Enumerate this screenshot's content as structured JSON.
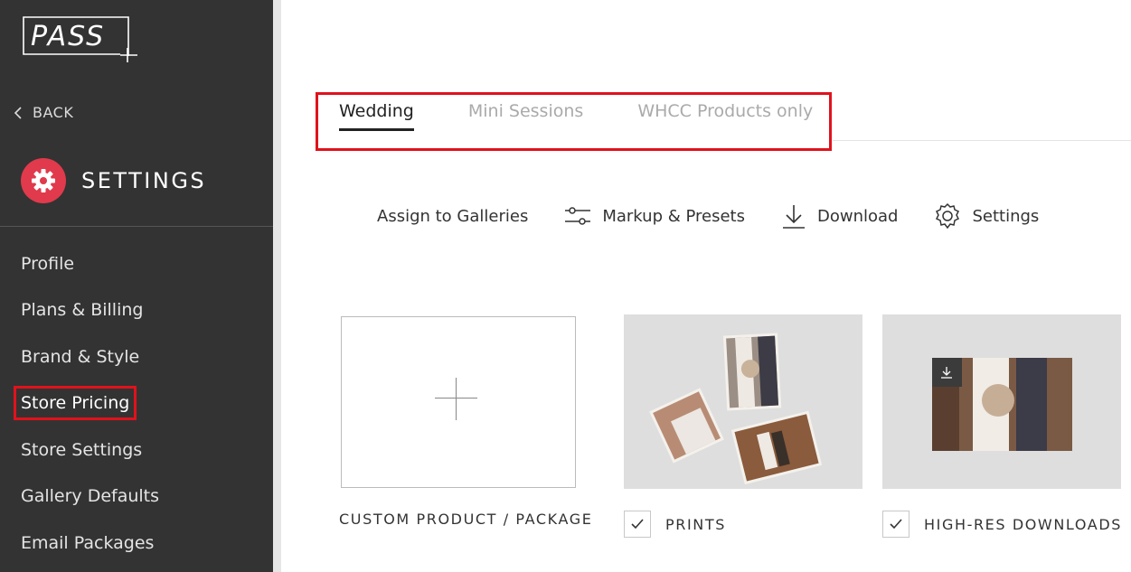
{
  "sidebar": {
    "logo_text": "PASS",
    "back_label": "BACK",
    "section_title": "SETTINGS",
    "items": [
      {
        "label": "Profile"
      },
      {
        "label": "Plans & Billing"
      },
      {
        "label": "Brand & Style"
      },
      {
        "label": "Store Pricing"
      },
      {
        "label": "Store Settings"
      },
      {
        "label": "Gallery Defaults"
      },
      {
        "label": "Email Packages"
      }
    ],
    "active_item": "Store Pricing"
  },
  "tabs": [
    {
      "label": "Wedding",
      "active": true
    },
    {
      "label": "Mini Sessions",
      "active": false
    },
    {
      "label": "WHCC Products only",
      "active": false
    }
  ],
  "toolbar": {
    "assign_label": "Assign to Galleries",
    "markup_label": "Markup & Presets",
    "download_label": "Download",
    "settings_label": "Settings"
  },
  "products": [
    {
      "label": "CUSTOM PRODUCT / PACKAGE",
      "checked": null
    },
    {
      "label": "PRINTS",
      "checked": true
    },
    {
      "label": "HIGH-RES DOWNLOADS",
      "checked": true
    }
  ],
  "colors": {
    "sidebar_bg": "#333333",
    "accent": "#e03a4c",
    "highlight_box": "#e0121c"
  }
}
